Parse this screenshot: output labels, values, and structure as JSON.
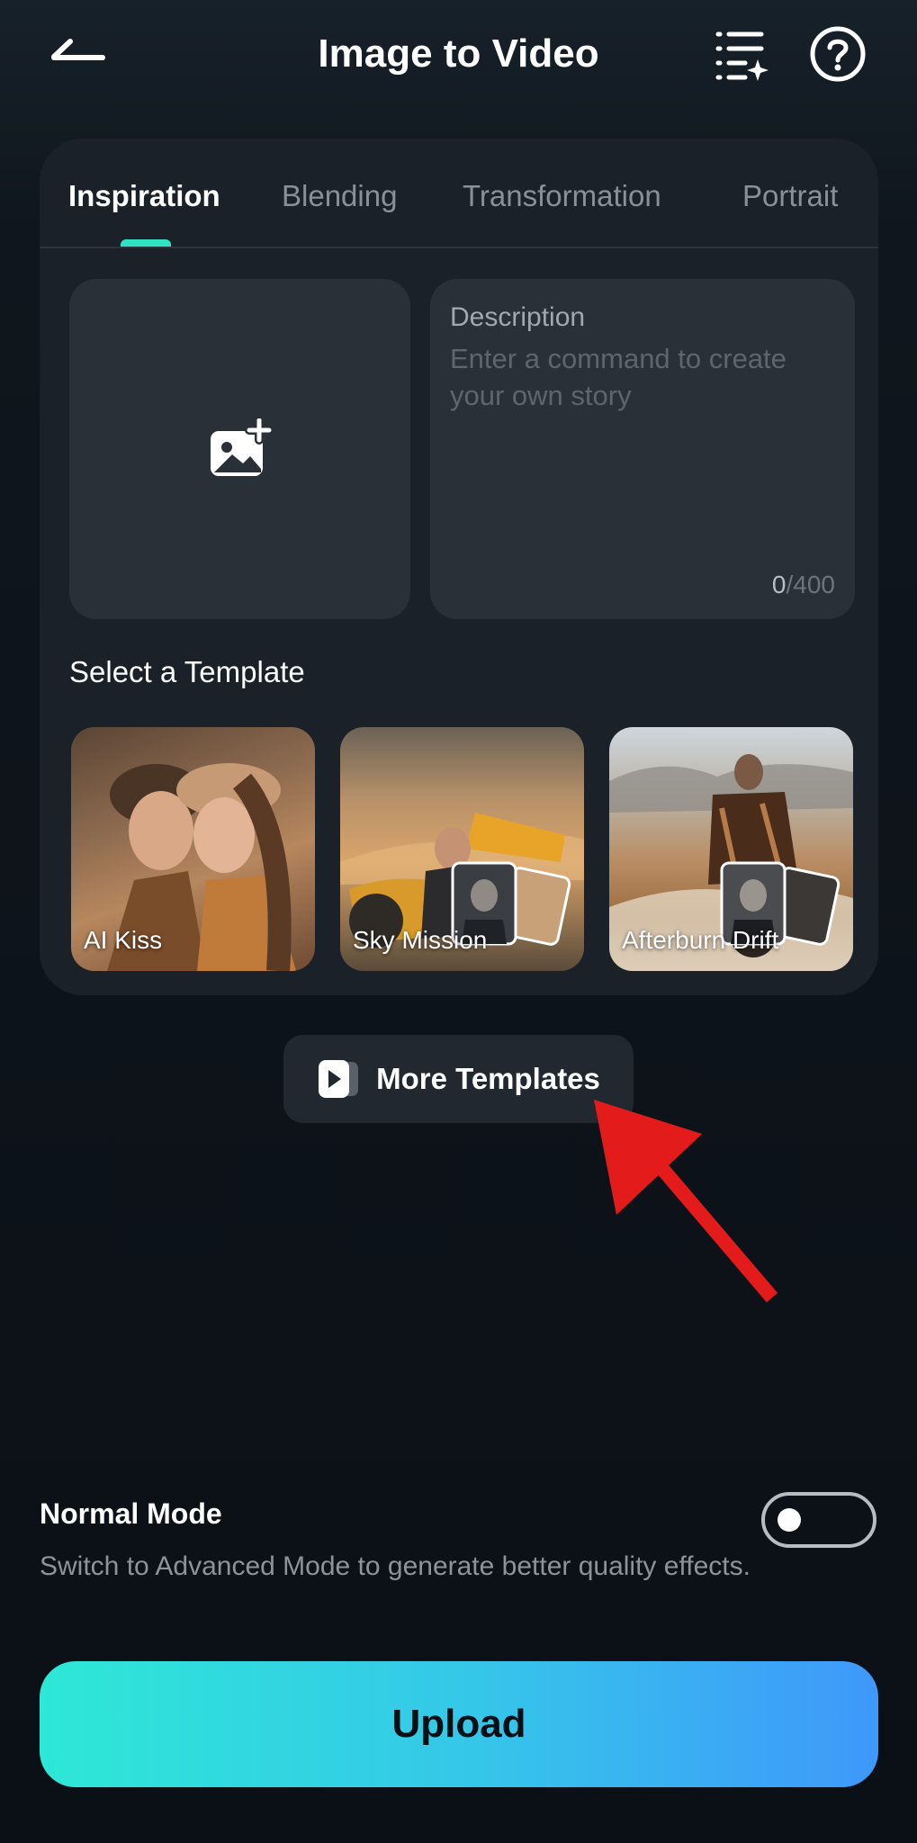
{
  "header": {
    "title": "Image to Video",
    "back_icon": "back-arrow-icon",
    "history_icon": "list-sparkle-icon",
    "help_icon": "question-circle-icon"
  },
  "tabs": [
    {
      "label": "Inspiration",
      "active": true
    },
    {
      "label": "Blending",
      "active": false
    },
    {
      "label": "Transformation",
      "active": false
    },
    {
      "label": "Portrait",
      "active": false
    }
  ],
  "upload_box": {
    "icon": "add-image-icon"
  },
  "description": {
    "label": "Description",
    "placeholder": "Enter a command to create your own story",
    "count_current": "0",
    "count_max": "/400"
  },
  "templates": {
    "section_title": "Select a Template",
    "items": [
      {
        "label": "AI Kiss"
      },
      {
        "label": "Sky Mission"
      },
      {
        "label": "Afterburn Drift"
      }
    ]
  },
  "more_templates": {
    "label": "More Templates",
    "icon": "video-play-icon"
  },
  "mode": {
    "title": "Normal Mode",
    "description": "Switch to Advanced Mode to generate better quality effects.",
    "toggle_on": false
  },
  "upload_button": {
    "label": "Upload"
  },
  "colors": {
    "accent_teal": "#2fe3c2",
    "gradient_start": "#2de8d6",
    "gradient_end": "#3f98fb",
    "annotation_arrow": "#e31b1b"
  }
}
